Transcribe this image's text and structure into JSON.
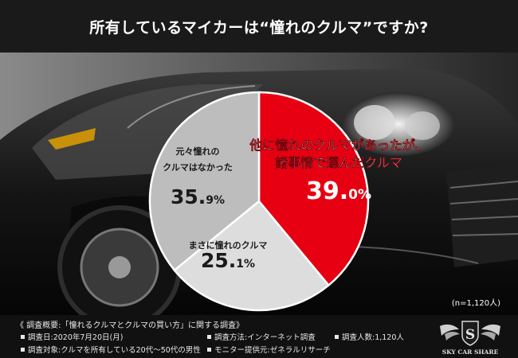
{
  "title": "所有しているマイカーは“憧れのクルマ”ですか?",
  "chart_data": {
    "type": "pie",
    "categories": [
      "他に憧れのクルマがあったが、諸事情で選んだクルマ",
      "まさに憧れのクルマ",
      "元々憧れのクルマはなかった"
    ],
    "values": [
      39.0,
      25.1,
      35.9
    ],
    "label_lines": [
      [
        "他に憧れのクルマがあったが、",
        "諸事情で選んだクルマ"
      ],
      [
        "まさに憧れのクルマ"
      ],
      [
        "元々憧れの",
        "クルマはなかった"
      ]
    ],
    "value_main": [
      "39.",
      "25.",
      "35."
    ],
    "value_frac": [
      "0%",
      "1%",
      "9%"
    ],
    "colors": [
      "#e60012",
      "#dddddd",
      "#bdbdbd"
    ],
    "sample_note": "(n=1,120人)"
  },
  "footer": {
    "heading": "《 調査概要:「憧れるクルマとクルマの買い方」に関する調査》",
    "date": "調査日:2020年7月20日(月)",
    "method": "調査方法:インターネット調査",
    "count": "調査人数:1,120人",
    "target": "調査対象:クルマを所有している20代〜50代の男性",
    "provider": "モニター提供元:ゼネラルリサーチ"
  },
  "logo": {
    "letter": "S",
    "text": "SKY CAR SHARE"
  }
}
